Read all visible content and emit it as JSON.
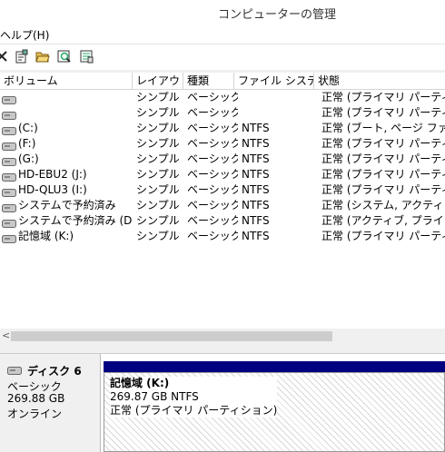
{
  "window": {
    "title": "コンピューターの管理"
  },
  "menu": {
    "help_label": "ヘルプ(H)"
  },
  "toolbar": {
    "icons": [
      "close-icon",
      "properties-icon",
      "open-folder-icon",
      "search-icon",
      "help-icon"
    ]
  },
  "volume_table": {
    "columns": [
      "ボリューム",
      "レイアウト",
      "種類",
      "ファイル システム",
      "状態"
    ],
    "rows": [
      {
        "volume": "",
        "layout": "シンプル",
        "type": "ベーシック",
        "fs": "",
        "status": "正常 (プライマリ パーティション)"
      },
      {
        "volume": "",
        "layout": "シンプル",
        "type": "ベーシック",
        "fs": "",
        "status": "正常 (プライマリ パーティション)"
      },
      {
        "volume": "(C:)",
        "layout": "シンプル",
        "type": "ベーシック",
        "fs": "NTFS",
        "status": "正常 (ブート, ページ ファイル"
      },
      {
        "volume": "(F:)",
        "layout": "シンプル",
        "type": "ベーシック",
        "fs": "NTFS",
        "status": "正常 (プライマリ パーティション)"
      },
      {
        "volume": "(G:)",
        "layout": "シンプル",
        "type": "ベーシック",
        "fs": "NTFS",
        "status": "正常 (プライマリ パーティション)"
      },
      {
        "volume": "HD-EBU2 (J:)",
        "layout": "シンプル",
        "type": "ベーシック",
        "fs": "NTFS",
        "status": "正常 (プライマリ パーティション)"
      },
      {
        "volume": "HD-QLU3 (I:)",
        "layout": "シンプル",
        "type": "ベーシック",
        "fs": "NTFS",
        "status": "正常 (プライマリ パーティション)"
      },
      {
        "volume": "システムで予約済み",
        "layout": "シンプル",
        "type": "ベーシック",
        "fs": "NTFS",
        "status": "正常 (システム, アクティブ, プ"
      },
      {
        "volume": "システムで予約済み (D:)",
        "layout": "シンプル",
        "type": "ベーシック",
        "fs": "NTFS",
        "status": "正常 (アクティブ, プライマリ パ"
      },
      {
        "volume": "記憶域 (K:)",
        "layout": "シンプル",
        "type": "ベーシック",
        "fs": "NTFS",
        "status": "正常 (プライマリ パーティション)"
      }
    ]
  },
  "scrollbar": {
    "left_arrow": "<"
  },
  "disk": {
    "name": "ディスク 6",
    "type": "ベーシック",
    "size": "269.88 GB",
    "status": "オンライン",
    "partition": {
      "name": "記憶域 (K:)",
      "size_fs": "269.87 GB NTFS",
      "status": "正常 (プライマリ パーティション)"
    }
  },
  "colors": {
    "partition_header": "#000080"
  }
}
